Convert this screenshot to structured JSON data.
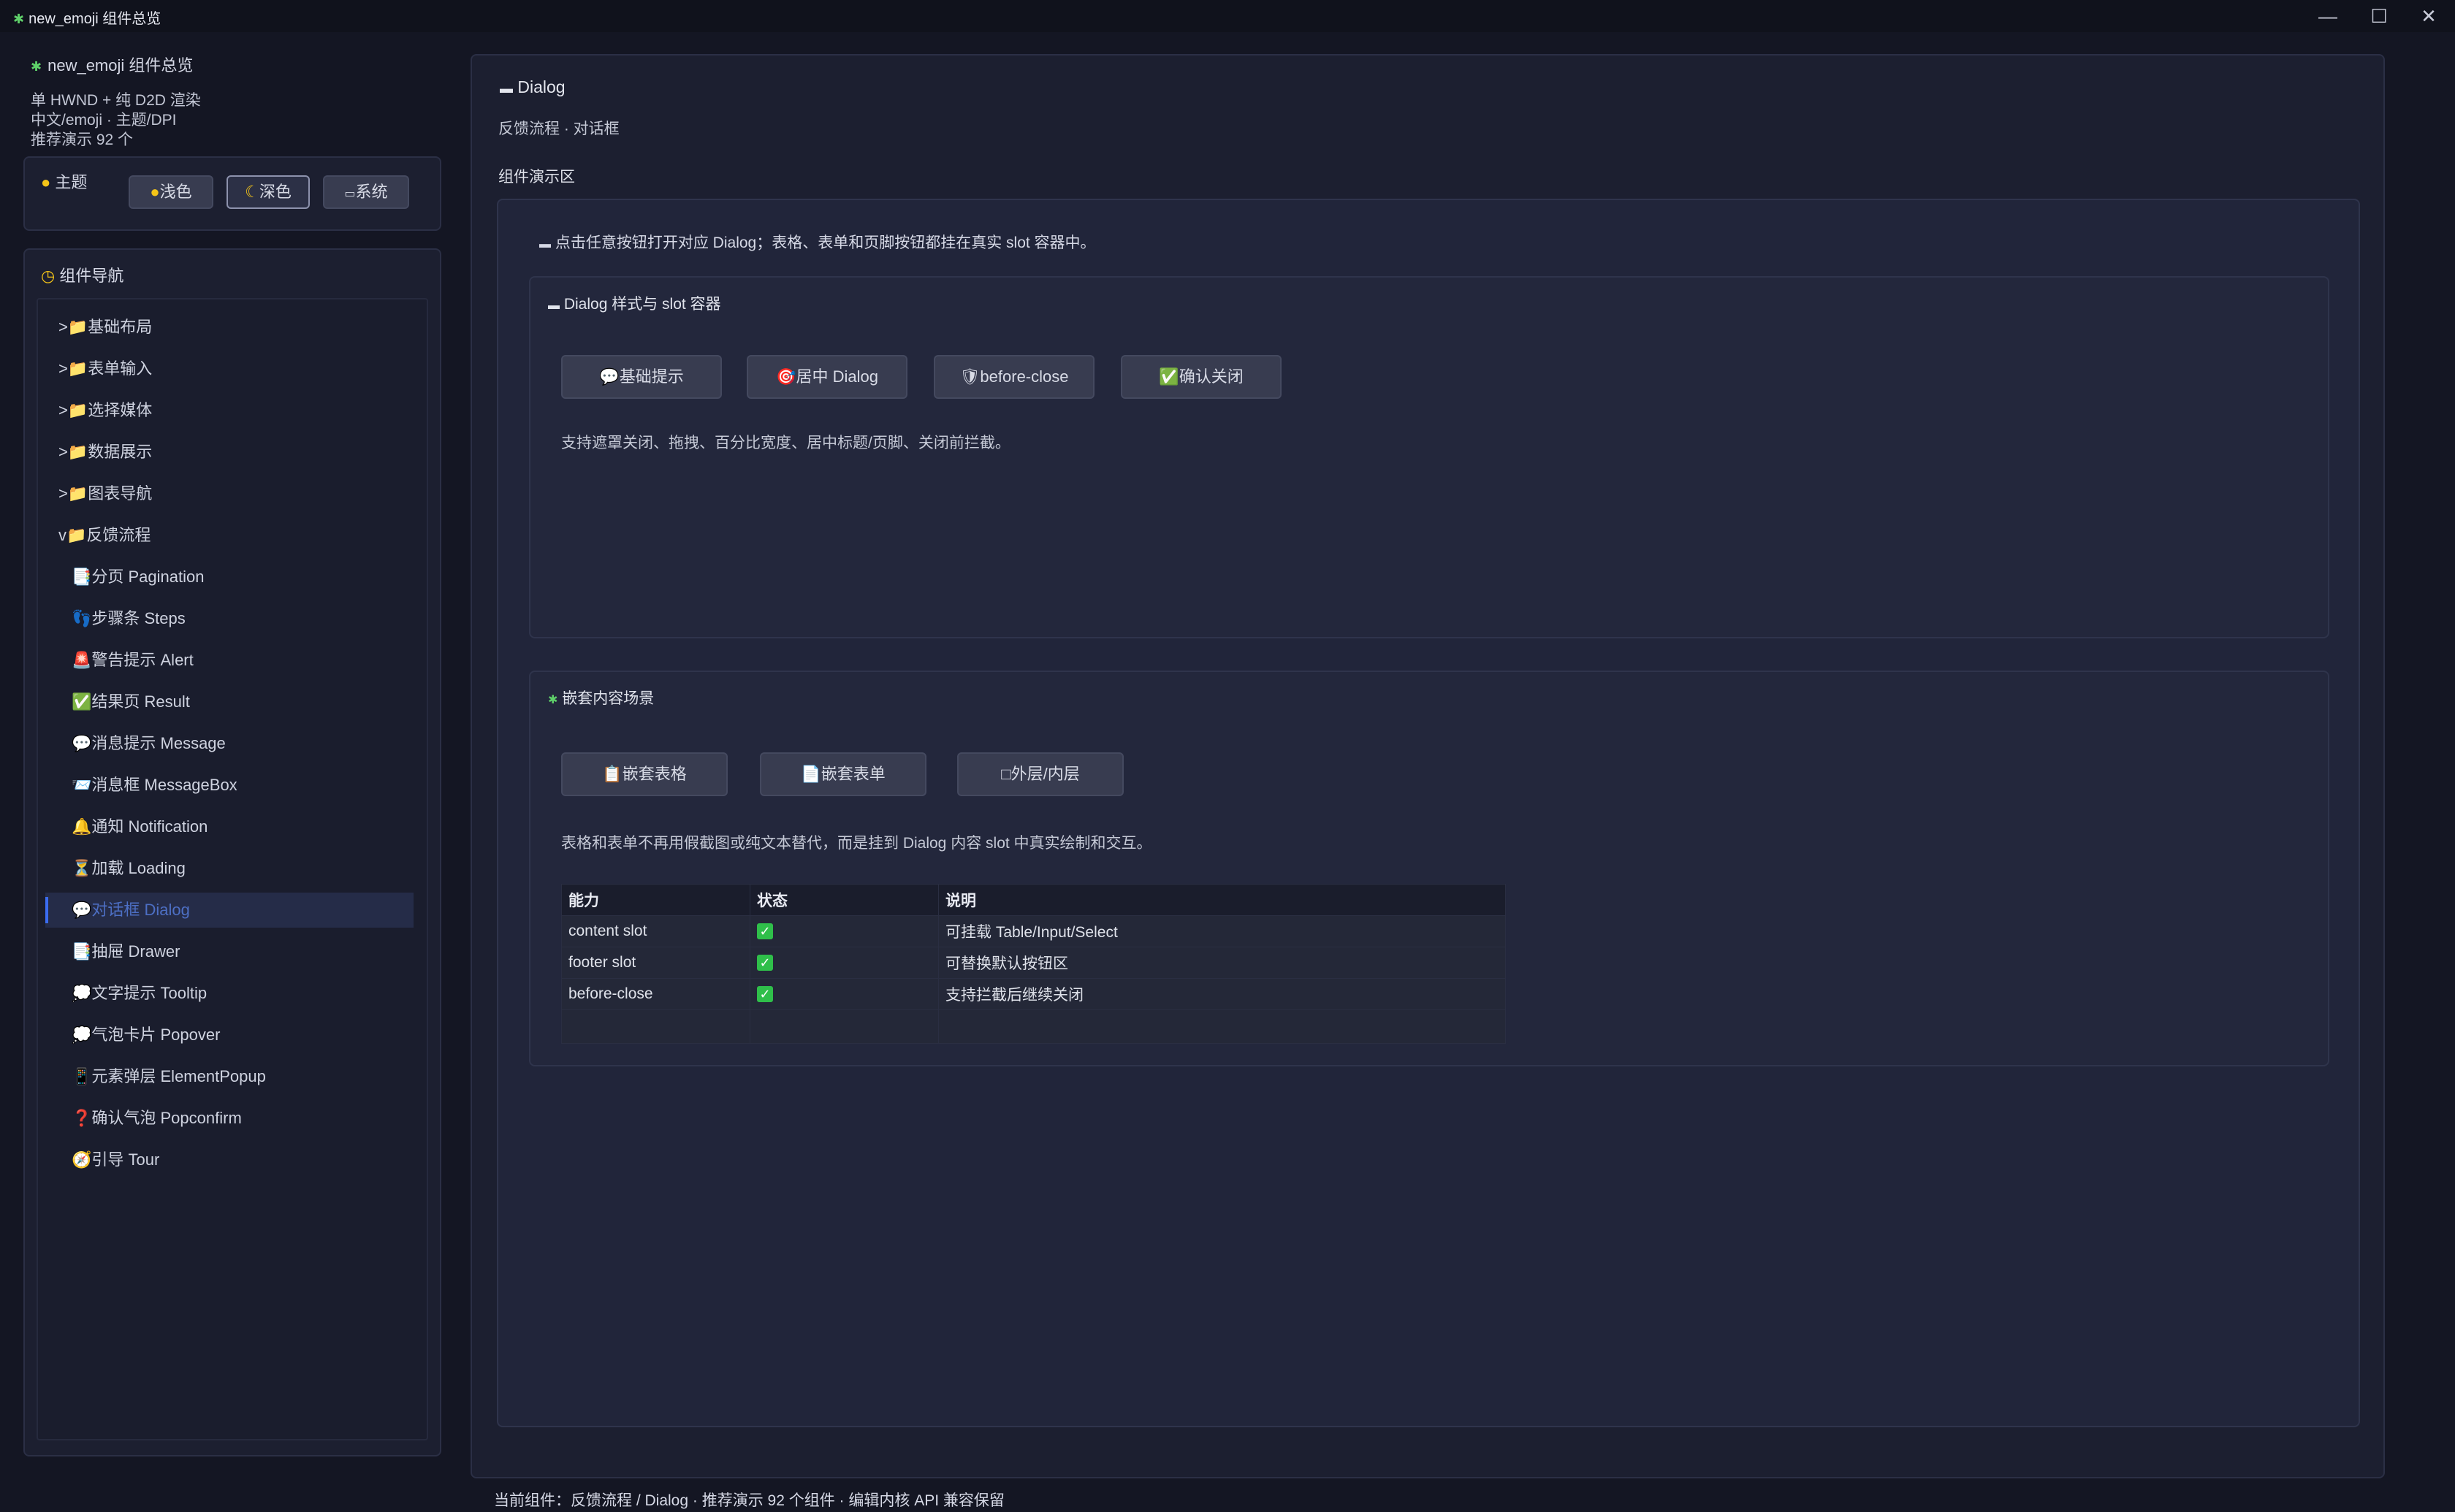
{
  "window": {
    "title": "new_emoji 组件总览",
    "controls": {
      "minimize": "—",
      "maximize": "☐",
      "close": "✕"
    }
  },
  "sidebar": {
    "app_title": "new_emoji 组件总览",
    "info_lines": [
      "单 HWND + 纯 D2D 渲染",
      "中文/emoji · 主题/DPI",
      "推荐演示 92 个"
    ],
    "theme": {
      "label": "主题",
      "options": [
        {
          "label": "浅色",
          "icon": "sun-icon"
        },
        {
          "label": "深色",
          "icon": "moon-icon",
          "selected": true
        },
        {
          "label": "系统",
          "icon": "laptop-icon"
        }
      ]
    },
    "nav": {
      "label": "组件导航",
      "items": [
        {
          "label": ">📁基础布局",
          "level": 0
        },
        {
          "label": ">📁表单输入",
          "level": 0
        },
        {
          "label": ">📁选择媒体",
          "level": 0
        },
        {
          "label": ">📁数据展示",
          "level": 0
        },
        {
          "label": ">📁图表导航",
          "level": 0
        },
        {
          "label": "v📁反馈流程",
          "level": 0
        },
        {
          "label": "📑分页 Pagination",
          "level": 1
        },
        {
          "label": "👣步骤条 Steps",
          "level": 1
        },
        {
          "label": "🚨警告提示 Alert",
          "level": 1
        },
        {
          "label": "✅结果页 Result",
          "level": 1
        },
        {
          "label": "💬消息提示 Message",
          "level": 1
        },
        {
          "label": "📨消息框 MessageBox",
          "level": 1
        },
        {
          "label": "🔔通知 Notification",
          "level": 1
        },
        {
          "label": "⏳加载 Loading",
          "level": 1
        },
        {
          "label": "💬对话框 Dialog",
          "level": 1,
          "active": true
        },
        {
          "label": "📑抽屉 Drawer",
          "level": 1
        },
        {
          "label": "💭文字提示 Tooltip",
          "level": 1
        },
        {
          "label": "💭气泡卡片 Popover",
          "level": 1
        },
        {
          "label": "📱元素弹层 ElementPopup",
          "level": 1
        },
        {
          "label": "❓确认气泡 Popconfirm",
          "level": 1
        },
        {
          "label": "🧭引导 Tour",
          "level": 1
        }
      ]
    }
  },
  "main": {
    "title": "Dialog",
    "subtitle": "反馈流程 · 对话框",
    "section_label": "组件演示区",
    "hint": "点击任意按钮打开对应 Dialog；表格、表单和页脚按钮都挂在真实 slot 容器中。",
    "card1": {
      "title": "Dialog 样式与 slot 容器",
      "buttons": [
        "💬基础提示",
        "🎯居中 Dialog",
        "🛡before-close",
        "✅确认关闭"
      ],
      "desc": "支持遮罩关闭、拖拽、百分比宽度、居中标题/页脚、关闭前拦截。"
    },
    "card2": {
      "title": "嵌套内容场景",
      "buttons": [
        "📋嵌套表格",
        "📄嵌套表单",
        "□外层/内层"
      ],
      "desc": "表格和表单不再用假截图或纯文本替代，而是挂到 Dialog 内容 slot 中真实绘制和交互。",
      "table": {
        "headers": [
          "能力",
          "状态",
          "说明"
        ],
        "rows": [
          [
            "content slot",
            "✓",
            "可挂载 Table/Input/Select"
          ],
          [
            "footer slot",
            "✓",
            "可替换默认按钮区"
          ],
          [
            "before-close",
            "✓",
            "支持拦截后继续关闭"
          ],
          [
            "",
            "",
            ""
          ]
        ]
      }
    }
  },
  "status_bar": "当前组件：反馈流程 / Dialog · 推荐演示 92 个组件 · 编辑内核 API 兼容保留"
}
